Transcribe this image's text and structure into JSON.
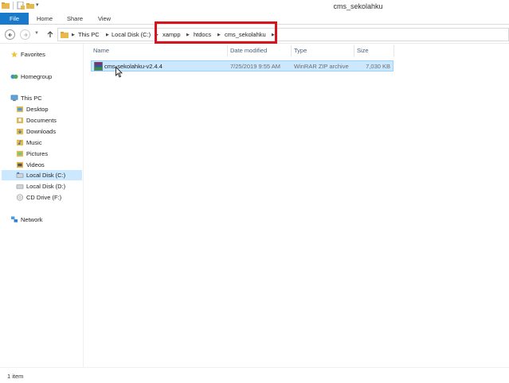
{
  "window": {
    "title": "cms_sekolahku"
  },
  "ribbon": {
    "tabs": {
      "file": "File",
      "home": "Home",
      "share": "Share",
      "view": "View"
    }
  },
  "address": {
    "crumbs": [
      "This PC",
      "Local Disk (C:)",
      "xampp",
      "htdocs",
      "cms_sekolahku"
    ]
  },
  "nav": {
    "favorites": "Favorites",
    "homegroup": "Homegroup",
    "this_pc": "This PC",
    "desktop": "Desktop",
    "documents": "Documents",
    "downloads": "Downloads",
    "music": "Music",
    "pictures": "Pictures",
    "videos": "Videos",
    "local_c": "Local Disk (C:)",
    "local_d": "Local Disk (D:)",
    "cd_drive": "CD Drive (F:)",
    "network": "Network"
  },
  "columns": {
    "name": "Name",
    "date": "Date modified",
    "type": "Type",
    "size": "Size"
  },
  "files": [
    {
      "name": "cms-sekolahku-v2.4.4",
      "date": "7/25/2019 9:55 AM",
      "type": "WinRAR ZIP archive",
      "size": "7,030 KB"
    }
  ],
  "status": {
    "item_count": "1 item"
  },
  "colors": {
    "accent": "#1979ca",
    "selection": "#cce8ff",
    "highlight": "#d7141e"
  }
}
